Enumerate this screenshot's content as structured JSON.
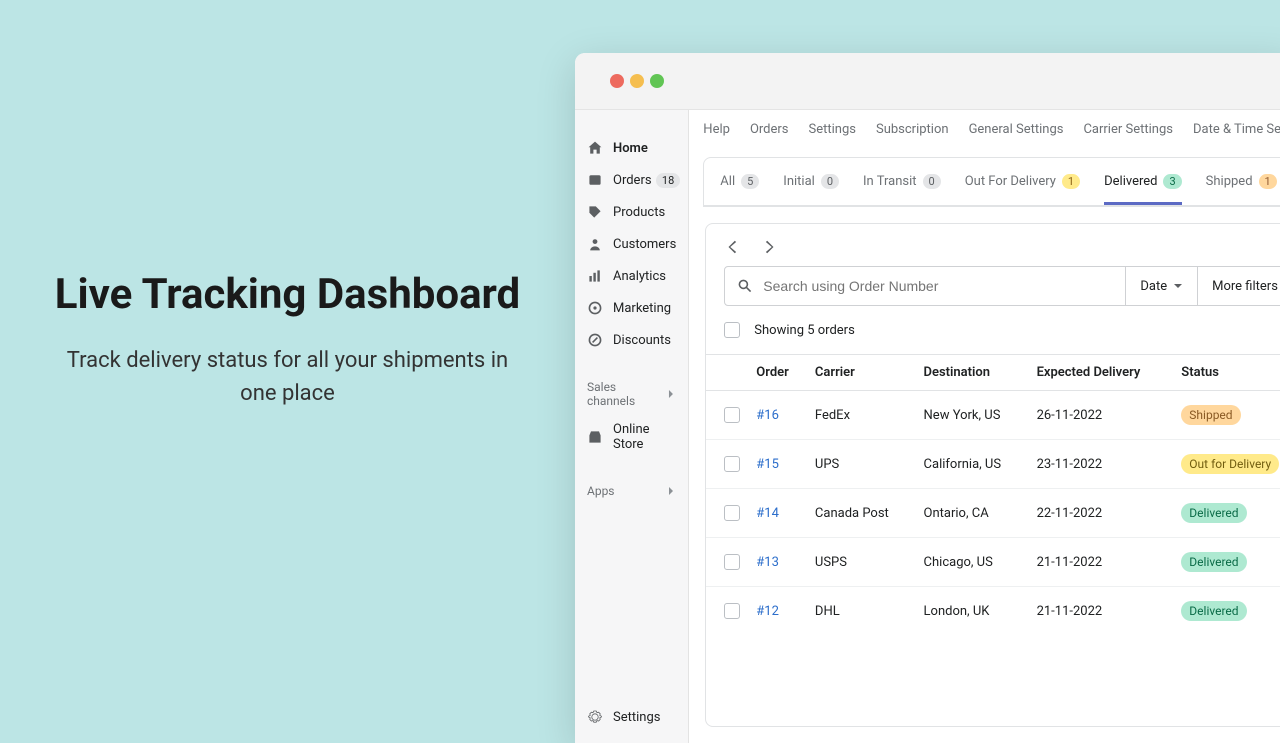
{
  "hero": {
    "title": "Live Tracking Dashboard",
    "subtitle": "Track delivery status for all your shipments in one place"
  },
  "sidebar": {
    "items": [
      {
        "label": "Home"
      },
      {
        "label": "Orders",
        "badge": "18"
      },
      {
        "label": "Products"
      },
      {
        "label": "Customers"
      },
      {
        "label": "Analytics"
      },
      {
        "label": "Marketing"
      },
      {
        "label": "Discounts"
      }
    ],
    "sections": {
      "sales_channels": "Sales channels",
      "online_store": "Online Store",
      "apps": "Apps"
    },
    "settings": "Settings"
  },
  "topnav": [
    "Help",
    "Orders",
    "Settings",
    "Subscription",
    "General Settings",
    "Carrier Settings",
    "Date & Time Settings"
  ],
  "tabs": [
    {
      "label": "All",
      "count": "5",
      "style": "gray"
    },
    {
      "label": "Initial",
      "count": "0",
      "style": "gray"
    },
    {
      "label": "In Transit",
      "count": "0",
      "style": "gray"
    },
    {
      "label": "Out For Delivery",
      "count": "1",
      "style": "yellow"
    },
    {
      "label": "Delivered",
      "count": "3",
      "style": "green",
      "active": true
    },
    {
      "label": "Shipped",
      "count": "1",
      "style": "orange"
    }
  ],
  "search": {
    "placeholder": "Search using Order Number"
  },
  "filters": {
    "date_label": "Date",
    "more_label": "More filters"
  },
  "showing": "Showing 5 orders",
  "table": {
    "columns": [
      "Order",
      "Carrier",
      "Destination",
      "Expected Delivery",
      "Status"
    ],
    "rows": [
      {
        "order": "#16",
        "carrier": "FedEx",
        "destination": "New York, US",
        "expected": "26-11-2022",
        "status": "Shipped",
        "status_class": "status-shipped"
      },
      {
        "order": "#15",
        "carrier": "UPS",
        "destination": "California, US",
        "expected": "23-11-2022",
        "status": "Out for Delivery",
        "status_class": "status-outfordelivery"
      },
      {
        "order": "#14",
        "carrier": "Canada Post",
        "destination": "Ontario, CA",
        "expected": "22-11-2022",
        "status": "Delivered",
        "status_class": "status-delivered"
      },
      {
        "order": "#13",
        "carrier": "USPS",
        "destination": "Chicago, US",
        "expected": "21-11-2022",
        "status": "Delivered",
        "status_class": "status-delivered"
      },
      {
        "order": "#12",
        "carrier": "DHL",
        "destination": "London, UK",
        "expected": "21-11-2022",
        "status": "Delivered",
        "status_class": "status-delivered"
      }
    ]
  }
}
